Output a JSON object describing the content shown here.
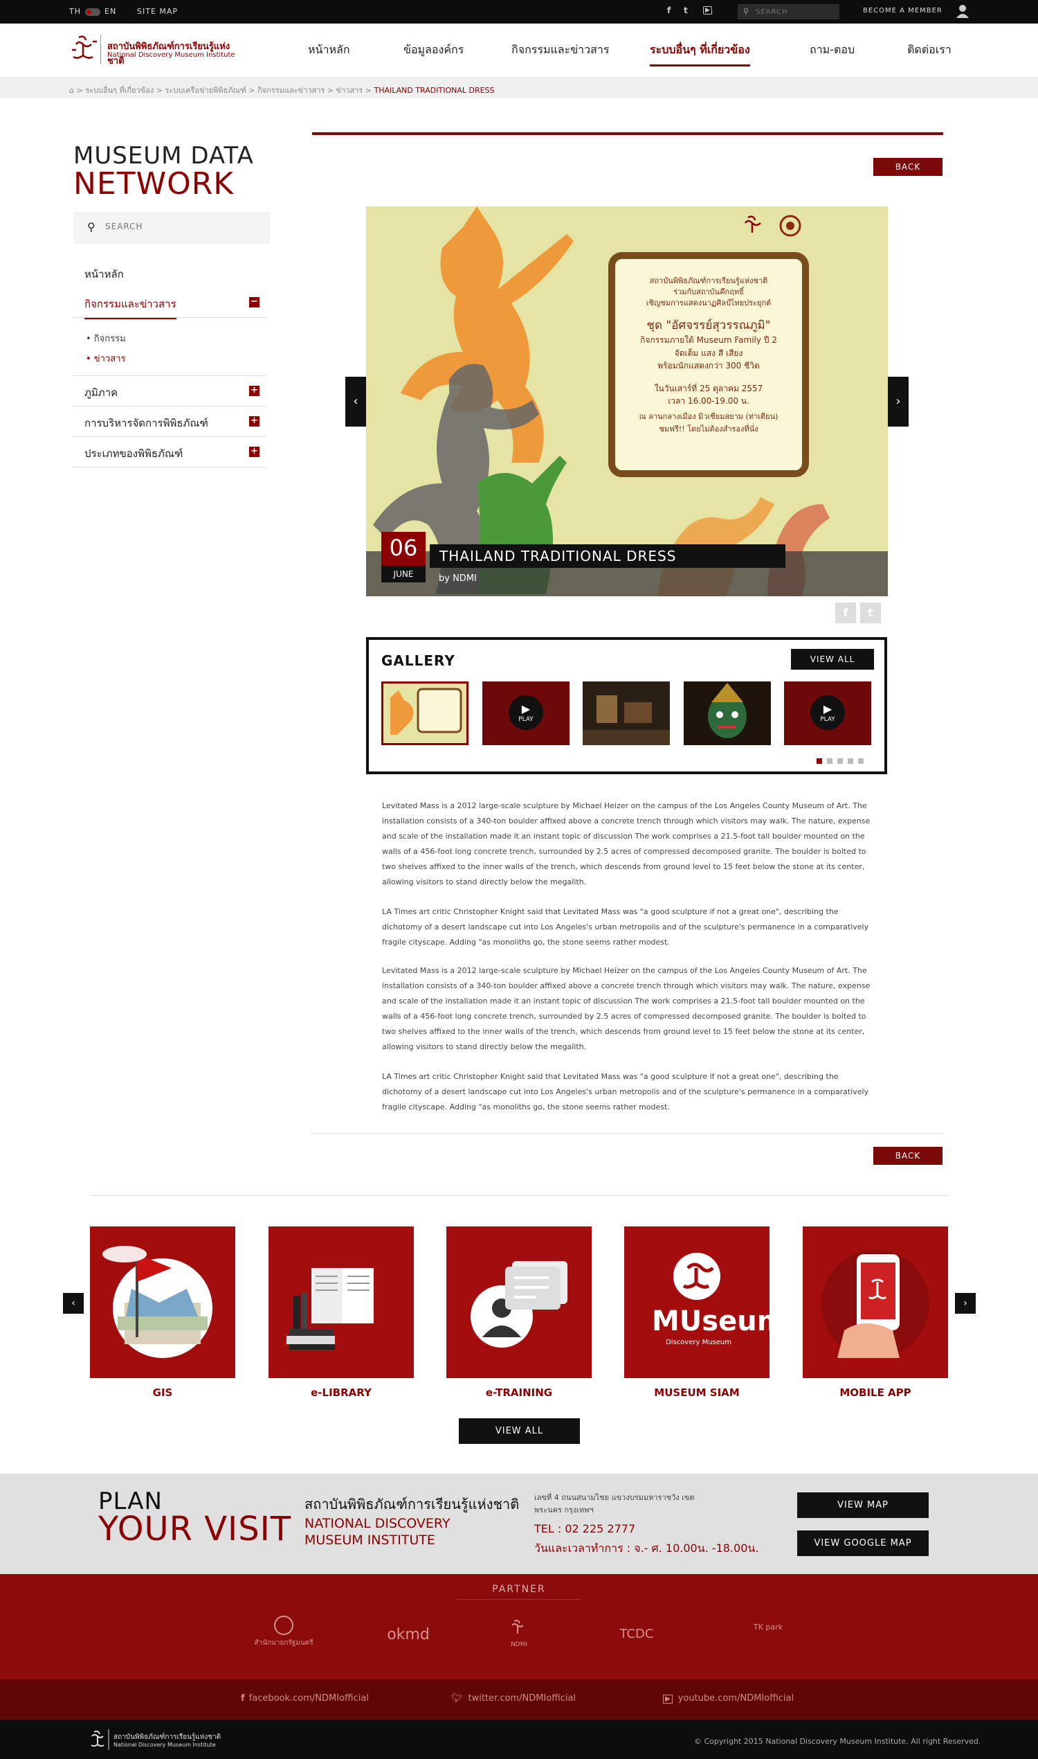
{
  "topbar": {
    "lang_th": "TH",
    "lang_en": "EN",
    "sitemap": "SITE MAP",
    "search_placeholder": "SEARCH",
    "member": "BECOME A MEMBER"
  },
  "header": {
    "logo_th": "สถาบันพิพิธภัณฑ์การเรียนรู้แห่งชาติ",
    "logo_en": "National Discovery Museum Institute",
    "nav": [
      "หน้าหลัก",
      "ข้อมูลองค์กร",
      "กิจกรรมและข่าวสาร",
      "ระบบอื่นๆ ที่เกี่ยวข้อง",
      "ถาม-ตอบ",
      "ติดต่อเรา"
    ]
  },
  "breadcrumb": [
    "ระบบอื่นๆ ที่เกี่ยวข้อง",
    "ระบบเครือข่ายพิพิธภัณฑ์",
    "กิจกรรมและข่าวสาร",
    "ข่าวสาร",
    "THAILAND TRADITIONAL DRESS"
  ],
  "sidebar": {
    "title1": "MUSEUM DATA",
    "title2": "NETWORK",
    "search_placeholder": "SEARCH",
    "items": [
      "หน้าหลัก",
      "กิจกรรมและข่าวสาร",
      "ภูมิภาค",
      "การบริหารจัดการพิพิธภัณฑ์",
      "ประเภทของพิพิธภัณฑ์"
    ],
    "sub": [
      "• กิจกรรม",
      "• ข่าวสาร"
    ]
  },
  "article": {
    "back": "BACK",
    "date_day": "06",
    "date_month": "JUNE",
    "title": "THAILAND TRADITIONAL DRESS",
    "by": "by NDMI",
    "poster": {
      "l1": "สถาบันพิพิธภัณฑ์การเรียนรู้แห่งชาติ",
      "l2": "ร่วมกับสถาบันคึกฤทธิ์",
      "l3": "เชิญชมการแสดงนาฏศิลป์ไทยประยุกต์",
      "l4": "ชุด \"อัศจรรย์สุวรรณภูมิ\"",
      "l5": "กิจกรรมภายใต้ Museum Family ปี 2",
      "l6": "จัดเต็ม แสง สี เสียง",
      "l7": "พร้อมนักแสดงกว่า 300 ชีวิต",
      "l8": "ในวันเสาร์ที่ 25 ตุลาคม 2557",
      "l9": "เวลา 16.00-19.00 น.",
      "l10": "ณ ลานกลางเมือง มิวเซียมสยาม (ท่าเตียน)",
      "l11": "ชมฟรี!! โดยไม่ต้องสำรองที่นั่ง"
    },
    "gallery_title": "GALLERY",
    "view_all": "VIEW ALL",
    "play": "PLAY",
    "paragraphs": [
      "Levitated Mass is a 2012 large-scale sculpture by Michael Heizer on the campus of the Los Angeles County Museum of Art. The installation consists of a 340-ton boulder affixed above a concrete trench through which visitors may walk. The nature, expense and scale of the installation made it an instant topic of discussion The work comprises a 21.5-foot tall boulder mounted on the walls of a 456-foot long concrete trench, surrounded by 2.5 acres of compressed decomposed granite. The boulder is bolted to two shelves affixed to the inner walls of the trench, which descends from ground level to 15 feet below the stone at its center, allowing visitors to stand directly below the megalith.",
      "LA Times art critic Christopher Knight said that Levitated Mass was \"a good sculpture if not a great one\", describing the dichotomy of a desert landscape cut into Los Angeles's urban metropolis and of the sculpture's permanence in a comparatively fragile cityscape. Adding \"as monoliths go, the stone seems rather modest.",
      "Levitated Mass is a 2012 large-scale sculpture by Michael Heizer on the campus of the Los Angeles County Museum of Art. The installation consists of a 340-ton boulder affixed above a concrete trench through which visitors may walk. The nature, expense and scale of the installation made it an instant topic of discussion The work comprises a 21.5-foot tall boulder mounted on the walls of a 456-foot long concrete trench, surrounded by 2.5 acres of compressed decomposed granite. The boulder is bolted to two shelves affixed to the inner walls of the trench, which descends from ground level to 15 feet below the stone at its center, allowing visitors to stand directly below the megalith.",
      "LA Times art critic Christopher Knight said that Levitated Mass was \"a good sculpture if not a great one\", describing the dichotomy of a desert landscape cut into Los Angeles's urban metropolis and of the sculpture's permanence in a comparatively fragile cityscape. Adding \"as monoliths go, the stone seems rather modest."
    ]
  },
  "services": {
    "tiles": [
      "GIS",
      "e-LIBRARY",
      "e-TRAINING",
      "MUSEUM SIAM",
      "MOBILE APP"
    ],
    "view_all": "VIEW ALL",
    "museum_logo": "MUseum siam",
    "museum_sub": "Discovery Museum"
  },
  "plan": {
    "l1": "PLAN",
    "l2": "YOUR VISIT",
    "th": "สถาบันพิพิธภัณฑ์การเรียนรู้แห่งชาติ",
    "en": "NATIONAL DISCOVERY MUSEUM INSTITUTE",
    "addr": "เลขที่ 4 ถนนสนามไชย แขวงบรมมหาราชวัง เขตพระนคร กรุงเทพฯ",
    "tel": "TEL : 02 225 2777",
    "hours": "วันและเวลาทำการ : จ.- ศ. 10.00น. -18.00น.",
    "btn_map": "VIEW MAP",
    "btn_gmap": "VIEW GOOGLE MAP"
  },
  "partner": {
    "title": "PARTNER",
    "logos": [
      "สำนักนายกรัฐมนตรี",
      "okmd",
      "NDMI",
      "TCDC",
      "TK park"
    ]
  },
  "social": {
    "fb": "facebook.com/NDMIofficial",
    "tw": "twitter.com/NDMIofficial",
    "yt": "youtube.com/NDMIofficial"
  },
  "footer": {
    "logo_th": "สถาบันพิพิธภัณฑ์การเรียนรู้แห่งชาติ",
    "logo_en": "National Discovery Museum Institute",
    "copyright": "© Copyright 2015 National Discovery Museum Institute, All right Reserved."
  },
  "colors": {
    "brand": "#8b0000",
    "dark": "#0d0d0d",
    "tile": "#a30d0d"
  }
}
